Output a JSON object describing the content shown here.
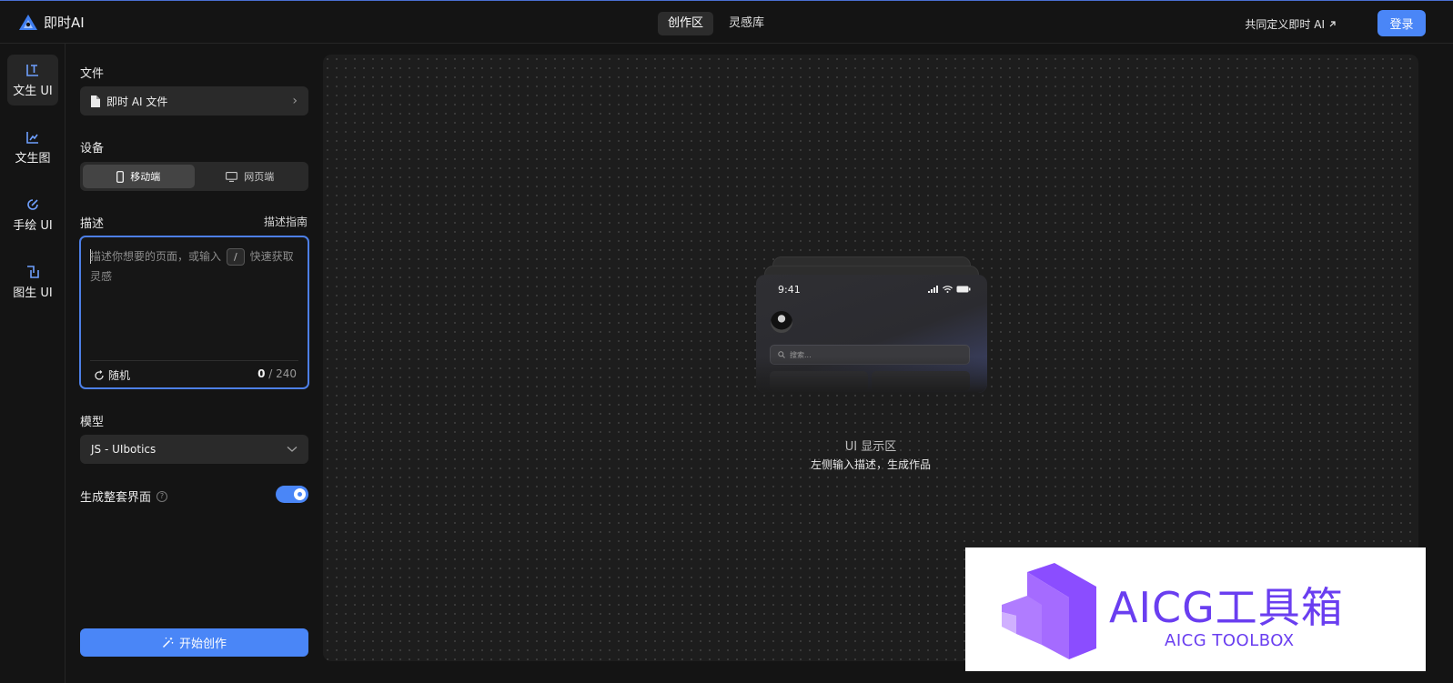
{
  "header": {
    "logo_text": "即时AI",
    "tabs": [
      {
        "label": "创作区",
        "active": true
      },
      {
        "label": "灵感库",
        "active": false
      }
    ],
    "define_link": "共同定义即时 AI",
    "login_label": "登录"
  },
  "rail": {
    "items": [
      {
        "label": "文生 UI",
        "icon": "text-ui-icon",
        "active": true
      },
      {
        "label": "文生图",
        "icon": "chart-icon",
        "active": false
      },
      {
        "label": "手绘 UI",
        "icon": "draw-icon",
        "active": false
      },
      {
        "label": "图生 UI",
        "icon": "image-ui-icon",
        "active": false
      }
    ]
  },
  "panel": {
    "file_label": "文件",
    "file_name": "即时 AI 文件",
    "device_label": "设备",
    "devices": [
      {
        "label": "移动端",
        "active": true
      },
      {
        "label": "网页端",
        "active": false
      }
    ],
    "desc_label": "描述",
    "desc_guide": "描述指南",
    "desc_placeholder_pre": "描述你想要的页面，或输入",
    "desc_slash": "/",
    "desc_placeholder_post": "快速获取灵感",
    "random_label": "随机",
    "counter_current": "0",
    "counter_sep": " / ",
    "counter_max": "240",
    "model_label": "模型",
    "model_value": "JS - UIbotics",
    "full_ui_label": "生成整套界面",
    "full_ui_on": true,
    "start_label": "开始创作"
  },
  "canvas": {
    "preview_time": "9:41",
    "preview_search": "搜索...",
    "display_title": "UI 显示区",
    "display_sub": "左侧输入描述，生成作品"
  },
  "watermark": {
    "main": "AICG工具箱",
    "sub": "AICG TOOLBOX"
  },
  "colors": {
    "accent": "#4a86f7",
    "bg": "#141414",
    "canvas": "#1d1d1d",
    "watermark": "#6a3ef0"
  }
}
